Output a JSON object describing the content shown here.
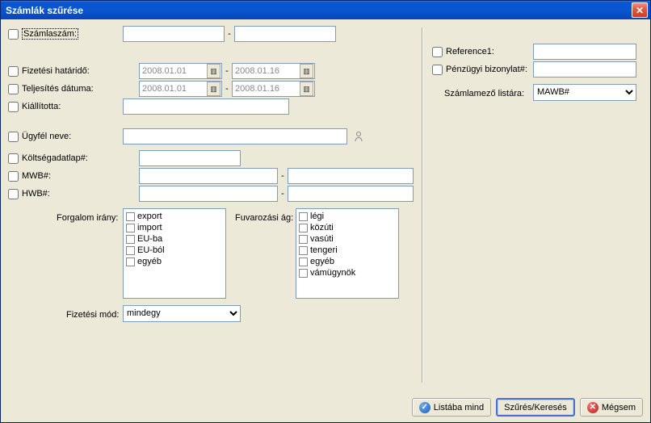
{
  "title": "Számlák szűrése",
  "left": {
    "szamlaszam": "Számlaszám:",
    "fizHatarido": "Fizetési határidő:",
    "teljesites": "Teljesítés dátuma:",
    "kiallitotta": "Kiállította:",
    "ugyfelNeve": "Ügyfél neve:",
    "koltsegadatlap": "Költségadatlap#:",
    "mwb": "MWB#:",
    "hwb": "HWB#:",
    "date1a": "2008.01.01",
    "date1b": "2008.01.16",
    "date2a": "2008.01.01",
    "date2b": "2008.01.16",
    "forgalomIrany": "Forgalom irány:",
    "forgalomItems": [
      "export",
      "import",
      "EU-ba",
      "EU-ból",
      "egyéb"
    ],
    "fuvarozasiAg": "Fuvarozási ág:",
    "fuvarozasiItems": [
      "légi",
      "közúti",
      "vasúti",
      "tengeri",
      "egyéb",
      "vámügynök"
    ],
    "fizetesiMod": "Fizetési mód:",
    "fizetesiModValue": "mindegy"
  },
  "right": {
    "reference1": "Reference1:",
    "penzugyi": "Pénzügyi bizonylat#:",
    "szamlamezo": "Számlamező listára:",
    "szamlamezoValue": "MAWB#"
  },
  "buttons": {
    "listabaMind": "Listába mind",
    "szures": "Szűrés/Keresés",
    "megsem": "Mégsem"
  },
  "dash": "-"
}
